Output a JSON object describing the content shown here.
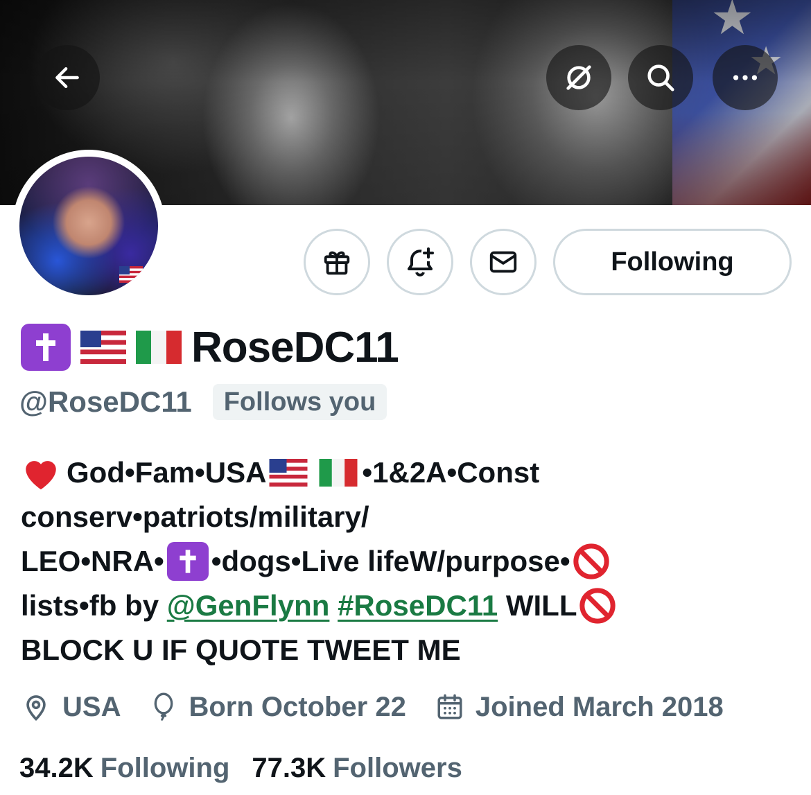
{
  "header": {
    "back_icon": "back-arrow-icon",
    "grok_icon": "grok-icon",
    "search_icon": "search-icon",
    "more_icon": "more-icon"
  },
  "actions": {
    "gift_icon": "gift-icon",
    "notify_icon": "bell-plus-icon",
    "message_icon": "envelope-icon",
    "following_label": "Following"
  },
  "profile": {
    "display_name": "RoseDC11",
    "handle": "@RoseDC11",
    "follows_you": "Follows you"
  },
  "bio": {
    "line1_text": "God•Fam•USA",
    "line1_tail": "•1&2A•Const",
    "line2": "conserv•patriots/military/",
    "line3_head": "LEO•NRA•",
    "line3_tail": "•dogs•Live lifeW/purpose•",
    "line4_head": "lists•fb by ",
    "mention": "@GenFlynn",
    "hashtag": "#RoseDC11",
    "line4_tail": " WILL",
    "line5": "BLOCK U IF QUOTE TWEET ME"
  },
  "meta": {
    "location": "USA",
    "birthday": "Born October 22",
    "joined": "Joined March 2018"
  },
  "stats": {
    "following_count": "34.2K",
    "following_label": "Following",
    "followers_count": "77.3K",
    "followers_label": "Followers"
  },
  "colors": {
    "link": "#1a7a43",
    "secondary_text": "#536471",
    "border": "#cfd9de",
    "badge_bg": "#eff3f4",
    "cross_badge": "#8e3fd0"
  }
}
